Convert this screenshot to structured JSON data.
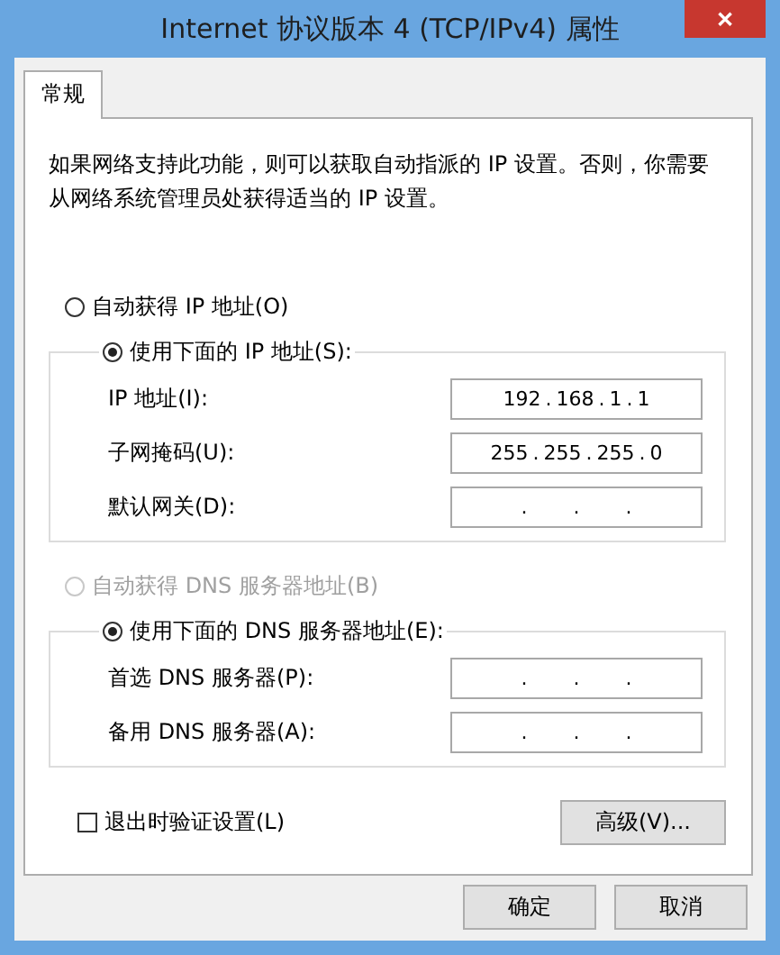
{
  "window": {
    "title": "Internet 协议版本 4 (TCP/IPv4) 属性",
    "close": "✕"
  },
  "tabs": [
    {
      "label": "常规",
      "selected": true
    }
  ],
  "description": "如果网络支持此功能，则可以获取自动指派的 IP 设置。否则，你需要从网络系统管理员处获得适当的 IP 设置。",
  "ip_section": {
    "radios": [
      {
        "label": "自动获得 IP 地址(O)",
        "selected": false,
        "disabled": false
      },
      {
        "label": "使用下面的 IP 地址(S):",
        "selected": true,
        "disabled": false
      }
    ],
    "fields": [
      {
        "label": "IP 地址(I):",
        "value": "192 . 168 . 1 . 1"
      },
      {
        "label": "子网掩码(U):",
        "value": "255 . 255 . 255 . 0"
      },
      {
        "label": "默认网关(D):",
        "value": ". . ."
      }
    ]
  },
  "dns_section": {
    "radios": [
      {
        "label": "自动获得 DNS 服务器地址(B)",
        "selected": false,
        "disabled": true
      },
      {
        "label": "使用下面的 DNS 服务器地址(E):",
        "selected": true,
        "disabled": false
      }
    ],
    "fields": [
      {
        "label": "首选 DNS 服务器(P):",
        "value": ". . ."
      },
      {
        "label": "备用 DNS 服务器(A):",
        "value": ". . ."
      }
    ]
  },
  "validate_checkbox": {
    "label": "退出时验证设置(L)",
    "checked": false
  },
  "advanced_button": "高级(V)...",
  "buttons": [
    "确定",
    "取消"
  ]
}
